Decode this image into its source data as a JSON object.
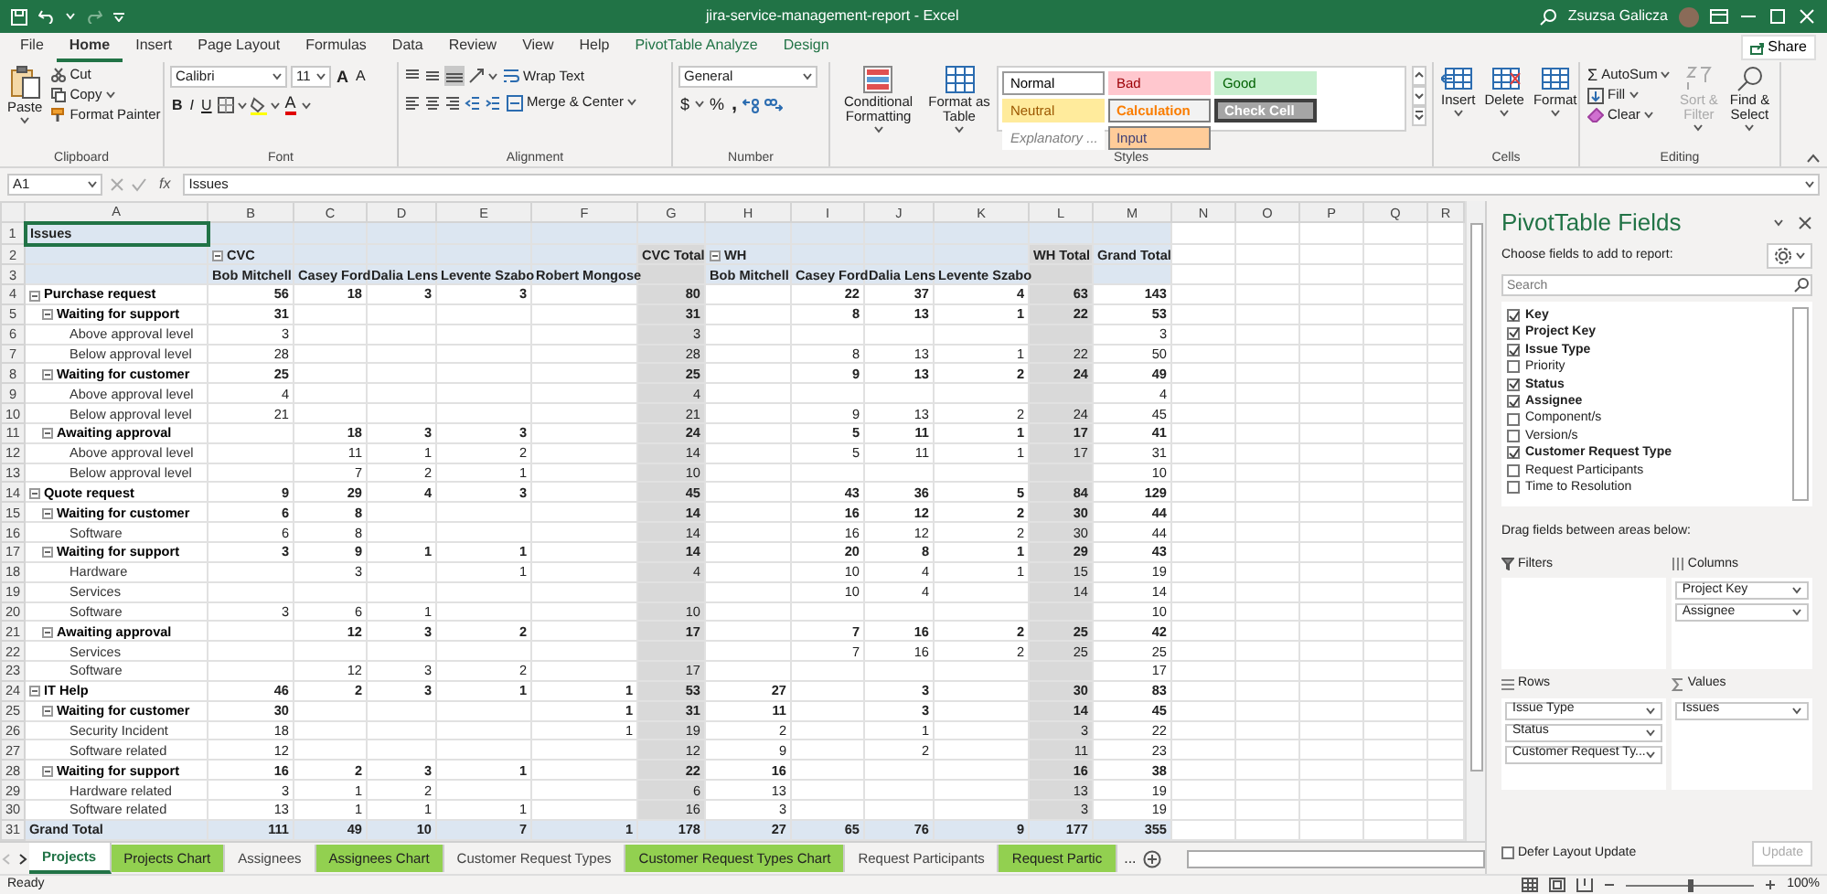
{
  "title_bar": {
    "title": "jira-service-management-report  -  Excel",
    "user": "Zsuzsa Galicza"
  },
  "ribbon_tabs": [
    {
      "label": "File",
      "selected": false,
      "kind": "standard"
    },
    {
      "label": "Home",
      "selected": true,
      "kind": "standard"
    },
    {
      "label": "Insert",
      "selected": false,
      "kind": "standard"
    },
    {
      "label": "Page Layout",
      "selected": false,
      "kind": "standard"
    },
    {
      "label": "Formulas",
      "selected": false,
      "kind": "standard"
    },
    {
      "label": "Data",
      "selected": false,
      "kind": "standard"
    },
    {
      "label": "Review",
      "selected": false,
      "kind": "standard"
    },
    {
      "label": "View",
      "selected": false,
      "kind": "standard"
    },
    {
      "label": "Help",
      "selected": false,
      "kind": "standard"
    },
    {
      "label": "PivotTable Analyze",
      "selected": false,
      "kind": "contextual"
    },
    {
      "label": "Design",
      "selected": false,
      "kind": "contextual"
    }
  ],
  "share": "Share",
  "clipboard": {
    "paste": "Paste",
    "cut": "Cut",
    "copy": "Copy",
    "format_painter": "Format Painter",
    "label": "Clipboard"
  },
  "font": {
    "name": "Calibri",
    "size": "11",
    "grow": "A",
    "shrink": "A",
    "styles": [
      "B",
      "I",
      "U"
    ],
    "font_color": "A",
    "label": "Font"
  },
  "alignment": {
    "wrap": "Wrap Text",
    "merge": "Merge & Center",
    "label": "Alignment"
  },
  "number": {
    "format": "General",
    "currency": "$",
    "percent": "%",
    "comma": ",",
    "label": "Number"
  },
  "styles": {
    "conditional": "Conditional Formatting",
    "format_table": "Format as Table",
    "label": "Styles",
    "gallery": [
      {
        "label": "Normal",
        "kind": "normal"
      },
      {
        "label": "Bad",
        "kind": "bad"
      },
      {
        "label": "Good",
        "kind": "good"
      },
      {
        "label": "Neutral",
        "kind": "neutral"
      },
      {
        "label": "Calculation",
        "kind": "calculation"
      },
      {
        "label": "Check Cell",
        "kind": "check"
      },
      {
        "label": "Explanatory ...",
        "kind": "explanatory"
      },
      {
        "label": "Input",
        "kind": "input"
      }
    ]
  },
  "cells": {
    "insert": "Insert",
    "delete": "Delete",
    "format": "Format",
    "label": "Cells"
  },
  "editing": {
    "autosum_symbol": "Σ",
    "autosum": "AutoSum",
    "fill": "Fill",
    "clear": "Clear",
    "sort": {
      "label": "Sort & Filter",
      "disabled": true
    },
    "find": "Find & Select",
    "label": "Editing"
  },
  "formula_bar": {
    "name_box": "A1",
    "fx": "fx",
    "formula": "Issues"
  },
  "sheet": {
    "columns": [
      "A",
      "B",
      "C",
      "D",
      "E",
      "F",
      "G",
      "H",
      "I",
      "J",
      "K",
      "L",
      "M",
      "N",
      "O",
      "P",
      "Q",
      "R"
    ],
    "row_numbers": [
      "1",
      "2",
      "3",
      "4",
      "5",
      "6",
      "7",
      "8",
      "9",
      "10",
      "11",
      "12",
      "13",
      "14",
      "15",
      "16",
      "17",
      "18",
      "19",
      "20",
      "21",
      "22",
      "23",
      "24",
      "25",
      "26",
      "27",
      "28",
      "29",
      "30",
      "31"
    ]
  },
  "pivot": {
    "title": "Issues",
    "projects": [
      {
        "name": "CVC",
        "expanded": true,
        "assignees": [
          "Bob Mitchell",
          "Casey Ford",
          "Dalia Lens",
          "Levente Szabo",
          "Robert Mongose"
        ],
        "total": "CVC Total"
      },
      {
        "name": "WH",
        "expanded": true,
        "assignees": [
          "Bob Mitchell",
          "Casey Ford",
          "Dalia Lens",
          "Levente Szabo"
        ],
        "total": "WH Total"
      }
    ],
    "grand_total_header": "Grand Total",
    "rows": [
      {
        "label": "Purchase request",
        "expanded": true,
        "cells": [
          {
            "value": "56"
          },
          {
            "value": "18"
          },
          {
            "value": "3"
          },
          {
            "value": "3"
          },
          {},
          {
            "value": "80"
          },
          {},
          {
            "value": "22"
          },
          {
            "value": "37"
          },
          {
            "value": "4"
          },
          {
            "value": "63"
          },
          {
            "value": "143"
          }
        ],
        "children": [
          {
            "label": "Waiting for support",
            "expanded": true,
            "cells": [
              {
                "value": "31"
              },
              {},
              {},
              {},
              {},
              {
                "value": "31"
              },
              {},
              {
                "value": "8"
              },
              {
                "value": "13"
              },
              {
                "value": "1"
              },
              {
                "value": "22"
              },
              {
                "value": "53"
              }
            ],
            "children": [
              {
                "label": "Above approval level",
                "cells": [
                  {
                    "value": "3"
                  },
                  {},
                  {},
                  {},
                  {},
                  {
                    "value": "3"
                  },
                  {},
                  {},
                  {},
                  {},
                  {},
                  {
                    "value": "3"
                  }
                ]
              },
              {
                "label": "Below approval level",
                "cells": [
                  {
                    "value": "28"
                  },
                  {},
                  {},
                  {},
                  {},
                  {
                    "value": "28"
                  },
                  {},
                  {
                    "value": "8"
                  },
                  {
                    "value": "13"
                  },
                  {
                    "value": "1"
                  },
                  {
                    "value": "22"
                  },
                  {
                    "value": "50"
                  }
                ]
              }
            ]
          },
          {
            "label": "Waiting for customer",
            "expanded": true,
            "cells": [
              {
                "value": "25"
              },
              {},
              {},
              {},
              {},
              {
                "value": "25"
              },
              {},
              {
                "value": "9"
              },
              {
                "value": "13"
              },
              {
                "value": "2"
              },
              {
                "value": "24"
              },
              {
                "value": "49"
              }
            ],
            "children": [
              {
                "label": "Above approval level",
                "cells": [
                  {
                    "value": "4"
                  },
                  {},
                  {},
                  {},
                  {},
                  {
                    "value": "4"
                  },
                  {},
                  {},
                  {},
                  {},
                  {},
                  {
                    "value": "4"
                  }
                ]
              },
              {
                "label": "Below approval level",
                "cells": [
                  {
                    "value": "21"
                  },
                  {},
                  {},
                  {},
                  {},
                  {
                    "value": "21"
                  },
                  {},
                  {
                    "value": "9"
                  },
                  {
                    "value": "13"
                  },
                  {
                    "value": "2"
                  },
                  {
                    "value": "24"
                  },
                  {
                    "value": "45"
                  }
                ]
              }
            ]
          },
          {
            "label": "Awaiting approval",
            "expanded": true,
            "cells": [
              {},
              {
                "value": "18"
              },
              {
                "value": "3"
              },
              {
                "value": "3"
              },
              {},
              {
                "value": "24"
              },
              {},
              {
                "value": "5"
              },
              {
                "value": "11"
              },
              {
                "value": "1"
              },
              {
                "value": "17"
              },
              {
                "value": "41"
              }
            ],
            "children": [
              {
                "label": "Above approval level",
                "cells": [
                  {},
                  {
                    "value": "11"
                  },
                  {
                    "value": "1"
                  },
                  {
                    "value": "2"
                  },
                  {},
                  {
                    "value": "14"
                  },
                  {},
                  {
                    "value": "5"
                  },
                  {
                    "value": "11"
                  },
                  {
                    "value": "1"
                  },
                  {
                    "value": "17"
                  },
                  {
                    "value": "31"
                  }
                ]
              },
              {
                "label": "Below approval level",
                "cells": [
                  {},
                  {
                    "value": "7"
                  },
                  {
                    "value": "2"
                  },
                  {
                    "value": "1"
                  },
                  {},
                  {
                    "value": "10"
                  },
                  {},
                  {},
                  {},
                  {},
                  {},
                  {
                    "value": "10"
                  }
                ]
              }
            ]
          }
        ]
      },
      {
        "label": "Quote request",
        "expanded": true,
        "cells": [
          {
            "value": "9"
          },
          {
            "value": "29"
          },
          {
            "value": "4"
          },
          {
            "value": "3"
          },
          {},
          {
            "value": "45"
          },
          {},
          {
            "value": "43"
          },
          {
            "value": "36"
          },
          {
            "value": "5"
          },
          {
            "value": "84"
          },
          {
            "value": "129"
          }
        ],
        "children": [
          {
            "label": "Waiting for customer",
            "expanded": true,
            "cells": [
              {
                "value": "6"
              },
              {
                "value": "8"
              },
              {},
              {},
              {},
              {
                "value": "14"
              },
              {},
              {
                "value": "16"
              },
              {
                "value": "12"
              },
              {
                "value": "2"
              },
              {
                "value": "30"
              },
              {
                "value": "44"
              }
            ],
            "children": [
              {
                "label": "Software",
                "cells": [
                  {
                    "value": "6"
                  },
                  {
                    "value": "8"
                  },
                  {},
                  {},
                  {},
                  {
                    "value": "14"
                  },
                  {},
                  {
                    "value": "16"
                  },
                  {
                    "value": "12"
                  },
                  {
                    "value": "2"
                  },
                  {
                    "value": "30"
                  },
                  {
                    "value": "44"
                  }
                ]
              }
            ]
          },
          {
            "label": "Waiting for support",
            "expanded": true,
            "cells": [
              {
                "value": "3"
              },
              {
                "value": "9"
              },
              {
                "value": "1"
              },
              {
                "value": "1"
              },
              {},
              {
                "value": "14"
              },
              {},
              {
                "value": "20"
              },
              {
                "value": "8"
              },
              {
                "value": "1"
              },
              {
                "value": "29"
              },
              {
                "value": "43"
              }
            ],
            "children": [
              {
                "label": "Hardware",
                "cells": [
                  {},
                  {
                    "value": "3"
                  },
                  {},
                  {
                    "value": "1"
                  },
                  {},
                  {
                    "value": "4"
                  },
                  {},
                  {
                    "value": "10"
                  },
                  {
                    "value": "4"
                  },
                  {
                    "value": "1"
                  },
                  {
                    "value": "15"
                  },
                  {
                    "value": "19"
                  }
                ]
              },
              {
                "label": "Services",
                "cells": [
                  {},
                  {},
                  {},
                  {},
                  {},
                  {},
                  {},
                  {
                    "value": "10"
                  },
                  {
                    "value": "4"
                  },
                  {},
                  {
                    "value": "14"
                  },
                  {
                    "value": "14"
                  }
                ]
              },
              {
                "label": "Software",
                "cells": [
                  {
                    "value": "3"
                  },
                  {
                    "value": "6"
                  },
                  {
                    "value": "1"
                  },
                  {},
                  {},
                  {
                    "value": "10"
                  },
                  {},
                  {},
                  {},
                  {},
                  {},
                  {
                    "value": "10"
                  }
                ]
              }
            ]
          },
          {
            "label": "Awaiting approval",
            "expanded": true,
            "cells": [
              {},
              {
                "value": "12"
              },
              {
                "value": "3"
              },
              {
                "value": "2"
              },
              {},
              {
                "value": "17"
              },
              {},
              {
                "value": "7"
              },
              {
                "value": "16"
              },
              {
                "value": "2"
              },
              {
                "value": "25"
              },
              {
                "value": "42"
              }
            ],
            "children": [
              {
                "label": "Services",
                "cells": [
                  {},
                  {},
                  {},
                  {},
                  {},
                  {},
                  {},
                  {
                    "value": "7"
                  },
                  {
                    "value": "16"
                  },
                  {
                    "value": "2"
                  },
                  {
                    "value": "25"
                  },
                  {
                    "value": "25"
                  }
                ]
              },
              {
                "label": "Software",
                "cells": [
                  {},
                  {
                    "value": "12"
                  },
                  {
                    "value": "3"
                  },
                  {
                    "value": "2"
                  },
                  {},
                  {
                    "value": "17"
                  },
                  {},
                  {},
                  {},
                  {},
                  {},
                  {
                    "value": "17"
                  }
                ]
              }
            ]
          }
        ]
      },
      {
        "label": "IT Help",
        "expanded": true,
        "cells": [
          {
            "value": "46"
          },
          {
            "value": "2"
          },
          {
            "value": "3"
          },
          {
            "value": "1"
          },
          {
            "value": "1"
          },
          {
            "value": "53"
          },
          {
            "value": "27"
          },
          {},
          {
            "value": "3"
          },
          {},
          {
            "value": "30"
          },
          {
            "value": "83"
          }
        ],
        "children": [
          {
            "label": "Waiting for customer",
            "expanded": true,
            "cells": [
              {
                "value": "30"
              },
              {},
              {},
              {},
              {
                "value": "1"
              },
              {
                "value": "31"
              },
              {
                "value": "11"
              },
              {},
              {
                "value": "3"
              },
              {},
              {
                "value": "14"
              },
              {
                "value": "45"
              }
            ],
            "children": [
              {
                "label": "Security Incident",
                "cells": [
                  {
                    "value": "18"
                  },
                  {},
                  {},
                  {},
                  {
                    "value": "1"
                  },
                  {
                    "value": "19"
                  },
                  {
                    "value": "2"
                  },
                  {},
                  {
                    "value": "1"
                  },
                  {},
                  {
                    "value": "3"
                  },
                  {
                    "value": "22"
                  }
                ]
              },
              {
                "label": "Software related",
                "cells": [
                  {
                    "value": "12"
                  },
                  {},
                  {},
                  {},
                  {},
                  {
                    "value": "12"
                  },
                  {
                    "value": "9"
                  },
                  {},
                  {
                    "value": "2"
                  },
                  {},
                  {
                    "value": "11"
                  },
                  {
                    "value": "23"
                  }
                ]
              }
            ]
          },
          {
            "label": "Waiting for support",
            "expanded": true,
            "cells": [
              {
                "value": "16"
              },
              {
                "value": "2"
              },
              {
                "value": "3"
              },
              {
                "value": "1"
              },
              {},
              {
                "value": "22"
              },
              {
                "value": "16"
              },
              {},
              {},
              {},
              {
                "value": "16"
              },
              {
                "value": "38"
              }
            ],
            "children": [
              {
                "label": "Hardware related",
                "cells": [
                  {
                    "value": "3"
                  },
                  {
                    "value": "1"
                  },
                  {
                    "value": "2"
                  },
                  {},
                  {},
                  {
                    "value": "6"
                  },
                  {
                    "value": "13"
                  },
                  {},
                  {},
                  {},
                  {
                    "value": "13"
                  },
                  {
                    "value": "19"
                  }
                ]
              },
              {
                "label": "Software related",
                "cells": [
                  {
                    "value": "13"
                  },
                  {
                    "value": "1"
                  },
                  {
                    "value": "1"
                  },
                  {
                    "value": "1"
                  },
                  {},
                  {
                    "value": "16"
                  },
                  {
                    "value": "3"
                  },
                  {},
                  {},
                  {},
                  {
                    "value": "3"
                  },
                  {
                    "value": "19"
                  }
                ]
              }
            ]
          }
        ]
      }
    ],
    "grand_total": {
      "label": "Grand Total",
      "cells": [
        {
          "value": "111"
        },
        {
          "value": "49"
        },
        {
          "value": "10"
        },
        {
          "value": "7"
        },
        {
          "value": "1"
        },
        {
          "value": "178"
        },
        {
          "value": "27"
        },
        {
          "value": "65"
        },
        {
          "value": "76"
        },
        {
          "value": "9"
        },
        {
          "value": "177"
        },
        {
          "value": "355"
        }
      ]
    }
  },
  "sheet_tabs": [
    {
      "label": "Projects",
      "selected": true
    },
    {
      "label": "Projects Chart",
      "selected": false,
      "color": "#92d050"
    },
    {
      "label": "Assignees",
      "selected": false
    },
    {
      "label": "Assignees Chart",
      "selected": false,
      "color": "#92d050"
    },
    {
      "label": "Customer Request Types",
      "selected": false
    },
    {
      "label": "Customer Request Types Chart",
      "selected": false,
      "color": "#92d050"
    },
    {
      "label": "Request Participants",
      "selected": false
    },
    {
      "label": "Request Partic",
      "selected": false,
      "color": "#92d050"
    }
  ],
  "more_tabs": "...",
  "status_bar": {
    "status": "Ready",
    "zoom": "100%",
    "zoom_level": {
      "level": 0.5
    }
  },
  "pivot_pane": {
    "title": "PivotTable Fields",
    "subtitle": "Choose fields to add to report:",
    "search_placeholder": "Search",
    "fields": [
      {
        "label": "Key",
        "checked": true
      },
      {
        "label": "Project Key",
        "checked": true
      },
      {
        "label": "Issue Type",
        "checked": true
      },
      {
        "label": "Priority",
        "checked": false
      },
      {
        "label": "Status",
        "checked": true
      },
      {
        "label": "Assignee",
        "checked": true
      },
      {
        "label": "Component/s",
        "checked": false
      },
      {
        "label": "Version/s",
        "checked": false
      },
      {
        "label": "Customer Request Type",
        "checked": true
      },
      {
        "label": "Request Participants",
        "checked": false
      },
      {
        "label": "Time to Resolution",
        "checked": false
      }
    ],
    "drag_hint": "Drag fields between areas below:",
    "areas": [
      {
        "kind": "filters",
        "label": "Filters"
      },
      {
        "kind": "columns",
        "label": "Columns",
        "items": [
          "Project Key",
          "Assignee"
        ]
      },
      {
        "kind": "rows",
        "label": "Rows",
        "items": [
          "Issue Type",
          "Status",
          "Customer Request Ty..."
        ]
      },
      {
        "kind": "values",
        "label": "Values",
        "items": [
          "Issues"
        ]
      }
    ],
    "defer": {
      "label": "Defer Layout Update",
      "checked": false
    },
    "update": {
      "label": "Update",
      "disabled": true
    }
  }
}
